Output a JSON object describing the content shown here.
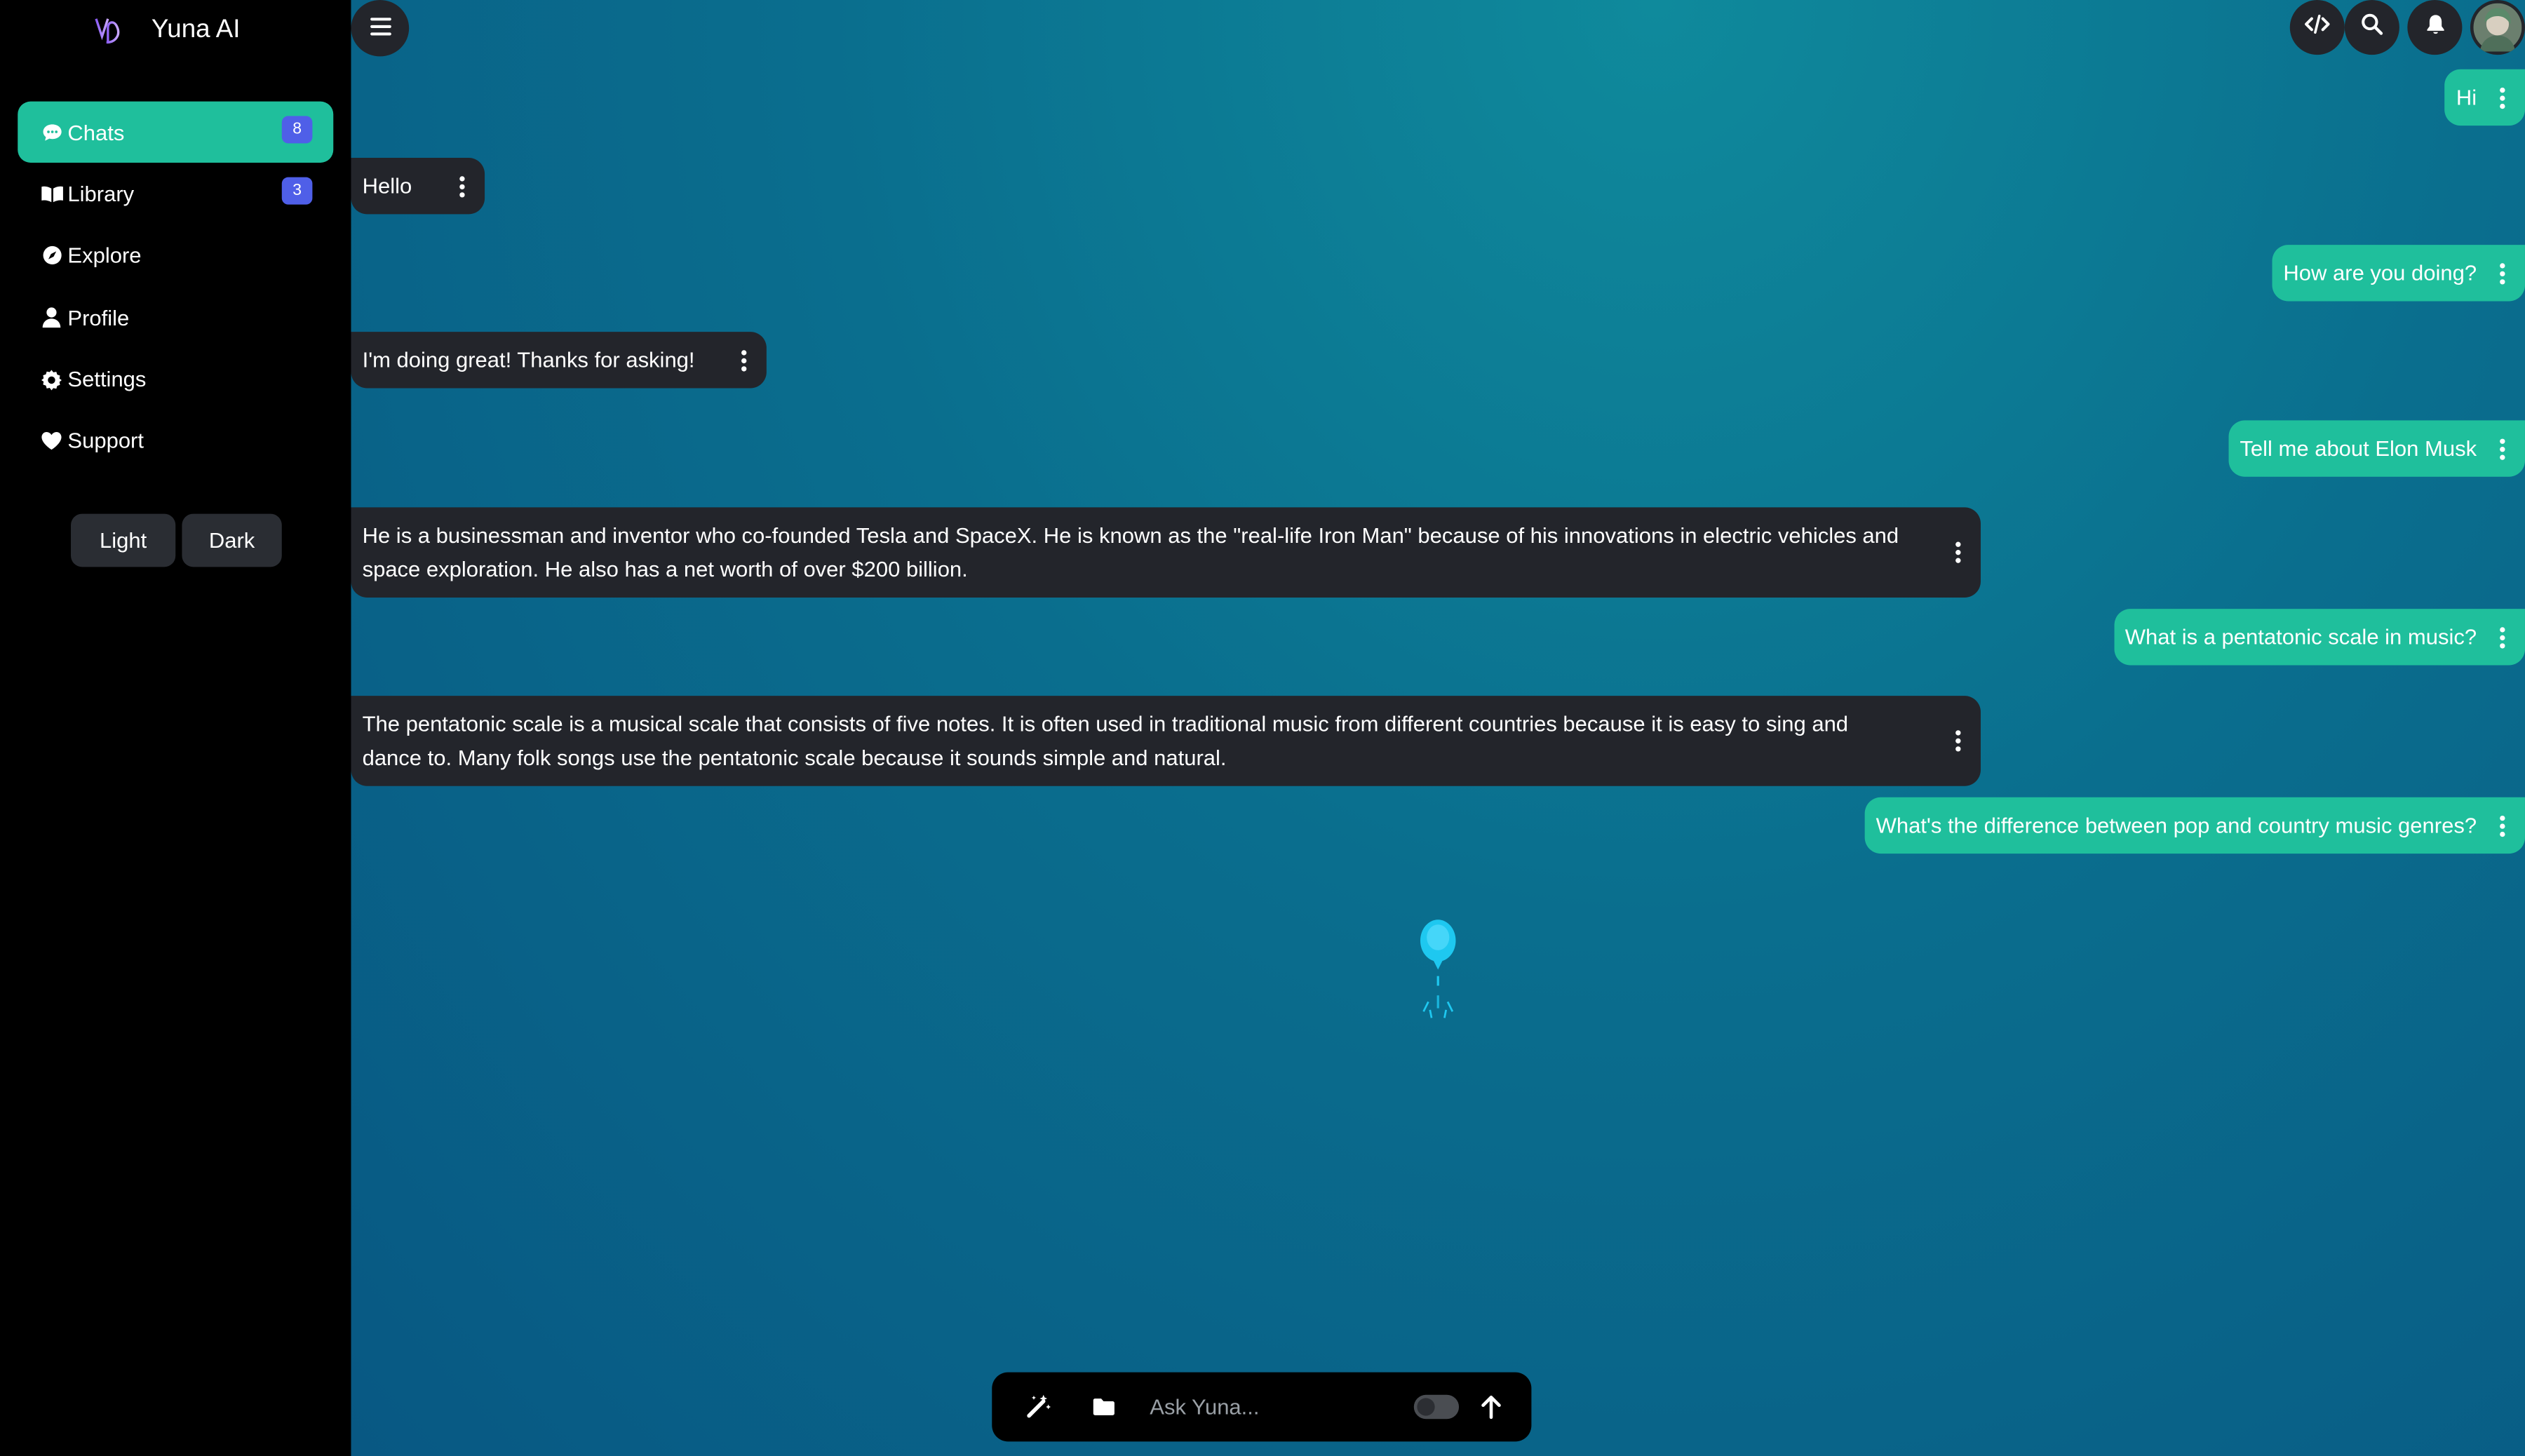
{
  "app": {
    "title": "Yuna AI"
  },
  "sidebar": {
    "items": [
      {
        "label": "Chats",
        "icon": "chat-icon",
        "badge": "8",
        "active": true
      },
      {
        "label": "Library",
        "icon": "book-icon",
        "badge": "3",
        "active": false
      },
      {
        "label": "Explore",
        "icon": "compass-icon",
        "badge": null,
        "active": false
      },
      {
        "label": "Profile",
        "icon": "user-icon",
        "badge": null,
        "active": false
      },
      {
        "label": "Settings",
        "icon": "gear-icon",
        "badge": null,
        "active": false
      },
      {
        "label": "Support",
        "icon": "heart-icon",
        "badge": null,
        "active": false
      }
    ],
    "theme": {
      "light_label": "Light",
      "dark_label": "Dark"
    }
  },
  "header": {
    "icons": [
      "code-icon",
      "search-icon",
      "bell-icon",
      "avatar"
    ]
  },
  "messages": [
    {
      "role": "user",
      "text": "Hi"
    },
    {
      "role": "bot",
      "text": "Hello"
    },
    {
      "role": "user",
      "text": "How are you doing?"
    },
    {
      "role": "bot",
      "text": "I'm doing great! Thanks for asking!"
    },
    {
      "role": "user",
      "text": "Tell me about Elon Musk"
    },
    {
      "role": "bot",
      "text": "He is a businessman and inventor who co-founded Tesla and SpaceX. He is known as the \"real-life Iron Man\" because of his innovations in electric vehicles and space exploration. He also has a net worth of over $200 billion."
    },
    {
      "role": "user",
      "text": "What is a pentatonic scale in music?"
    },
    {
      "role": "bot",
      "text": "The pentatonic scale is a musical scale that consists of five notes. It is often used in traditional music from different countries because it is easy to sing and dance to. Many folk songs use the pentatonic scale because it sounds simple and natural."
    },
    {
      "role": "user",
      "text": "What's the difference between pop and country music genres?"
    }
  ],
  "input": {
    "placeholder": "Ask Yuna..."
  },
  "colors": {
    "accent": "#1fbf9c",
    "sidebar": "#000000",
    "bubble_bot": "#23252b",
    "badge": "#4f5fe8"
  }
}
